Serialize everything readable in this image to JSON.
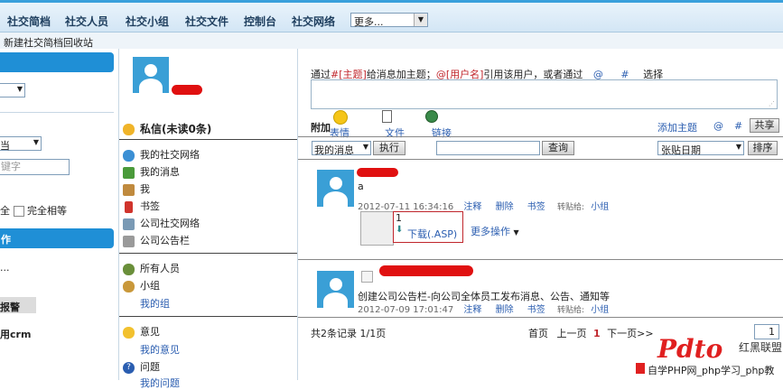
{
  "nav": {
    "items": [
      "社交简档",
      "社交人员",
      "社交小组",
      "社交文件",
      "控制台",
      "社交网络"
    ],
    "more_select": "更多..."
  },
  "subbar": {
    "text": "新建社交简档回收站"
  },
  "left": {
    "field_placeholder": "键字",
    "filter_select": "当",
    "exact_match": "完全相等",
    "partial_label": "全",
    "section2_header": "作",
    "section2_text": "...",
    "alarm_label": "报警",
    "crm_label": "用crm"
  },
  "mid": {
    "private_msg": "私信(未读0条)",
    "menu1": [
      "我的社交网络",
      "我的消息",
      "我",
      "书签",
      "公司社交网络",
      "公司公告栏"
    ],
    "all_people": "所有人员",
    "group": "小组",
    "my_group": "我的组",
    "opinion": "意见",
    "my_opinion": "我的意见",
    "question": "问题",
    "my_question": "我的问题"
  },
  "right": {
    "hint_prefix": "通过",
    "hint_topic": "#[主题]",
    "hint_mid": "给消息加主题；",
    "hint_user": "@[用户名]",
    "hint_mid2": "引用该用户，或者通过",
    "hint_at": "@",
    "hint_hash": "#",
    "hint_suffix": "选择",
    "attach_label": "附加",
    "emoji_label": "表情",
    "file_label": "文件",
    "link_label": "链接",
    "add_topic": "添加主题",
    "at": "@",
    "hash": "#",
    "share_button": "共享",
    "msg_select": "我的消息",
    "execute_button": "执行",
    "query_button": "查询",
    "sort_select": "张贴日期",
    "sort_button": "排序",
    "posts": [
      {
        "content": "a",
        "date": "2012-07-11 16:34:16",
        "actions": [
          "注释",
          "删除",
          "书签"
        ],
        "forward_label": "转贴给:",
        "forward_target": "小组",
        "attachment_count": "1",
        "download_label": "下载(.ASP)",
        "more_actions": "更多操作"
      },
      {
        "content": "创建公司公告栏-向公司全体员工发布消息、公告、通知等",
        "date": "2012-07-09 17:01:47",
        "actions": [
          "注释",
          "删除",
          "书签"
        ],
        "forward_label": "转贴给:",
        "forward_target": "小组"
      }
    ],
    "record_info": "共2条记录 1/1页",
    "pager": {
      "first": "首页",
      "prev": "上一页",
      "current": "1",
      "next": "下一页>>",
      "page_input": "1"
    }
  },
  "watermark": {
    "logo_text": "Pdto",
    "brand": "红黑联盟",
    "footer": "自学PHP网_php学习_php教"
  }
}
